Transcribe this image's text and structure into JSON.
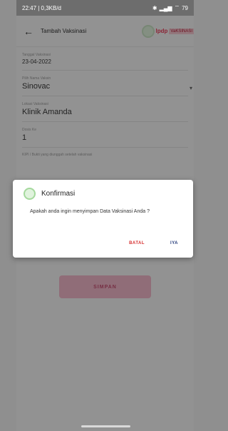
{
  "status": {
    "left": "22:47 | 0,3KB/d",
    "right": "79"
  },
  "appbar": {
    "title": "Tambah Vaksinasi",
    "logo_text": "lpdp",
    "logo_text2": "VaKSINASI"
  },
  "form": {
    "fields": [
      {
        "label": "Tanggal Vaksinasi",
        "value": "23-04-2022"
      },
      {
        "label": "Pilih Nama Vaksin",
        "value": "Sinovac"
      },
      {
        "label": "Lokasi Vaksinasi",
        "value": "Klinik Amanda"
      },
      {
        "label": "Dosis Ke",
        "value": "1"
      }
    ],
    "upload_label": "KIPI / Bukti yang diunggah setelah vaksinasi"
  },
  "buttons": {
    "save": "SIMPAN"
  },
  "dialog": {
    "title": "Konfirmasi",
    "message": "Apakah anda ingin menyimpan Data Vaksinasi Anda ?",
    "cancel": "BATAL",
    "ok": "IYA"
  }
}
